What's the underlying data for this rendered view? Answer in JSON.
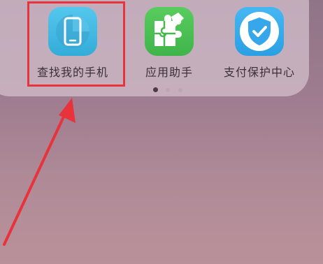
{
  "folder": {
    "apps": [
      {
        "label": "查找我的手机",
        "icon": "phone-icon",
        "color": "#3fb6e3"
      },
      {
        "label": "应用助手",
        "icon": "puzzle-icon",
        "color": "#4cbf53"
      },
      {
        "label": "支付保护中心",
        "icon": "shield-check-icon",
        "color": "#36aaeb"
      }
    ],
    "page_dots": {
      "count": 3,
      "active": 0
    }
  },
  "annotation": {
    "highlight_color": "#e8333c",
    "highlighted_app": "查找我的手机"
  }
}
